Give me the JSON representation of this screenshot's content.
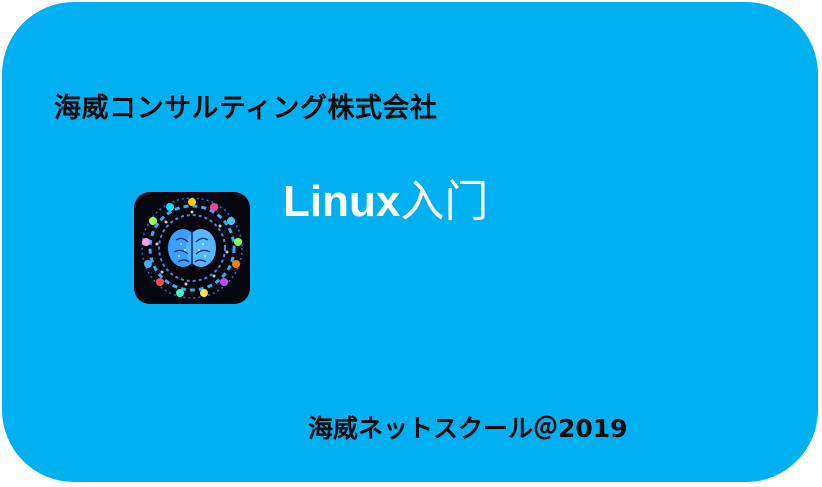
{
  "company_name": "海威コンサルティング株式会社",
  "title": {
    "latin": "Linux",
    "cjk": "入门"
  },
  "footer": "海威ネットスクール＠2019",
  "colors": {
    "card_background": "#00b0f0",
    "title_text": "#ffffff",
    "body_text": "#0a0a0a",
    "logo_background": "#05060d"
  },
  "logo": {
    "icon": "brain-network-icon"
  }
}
